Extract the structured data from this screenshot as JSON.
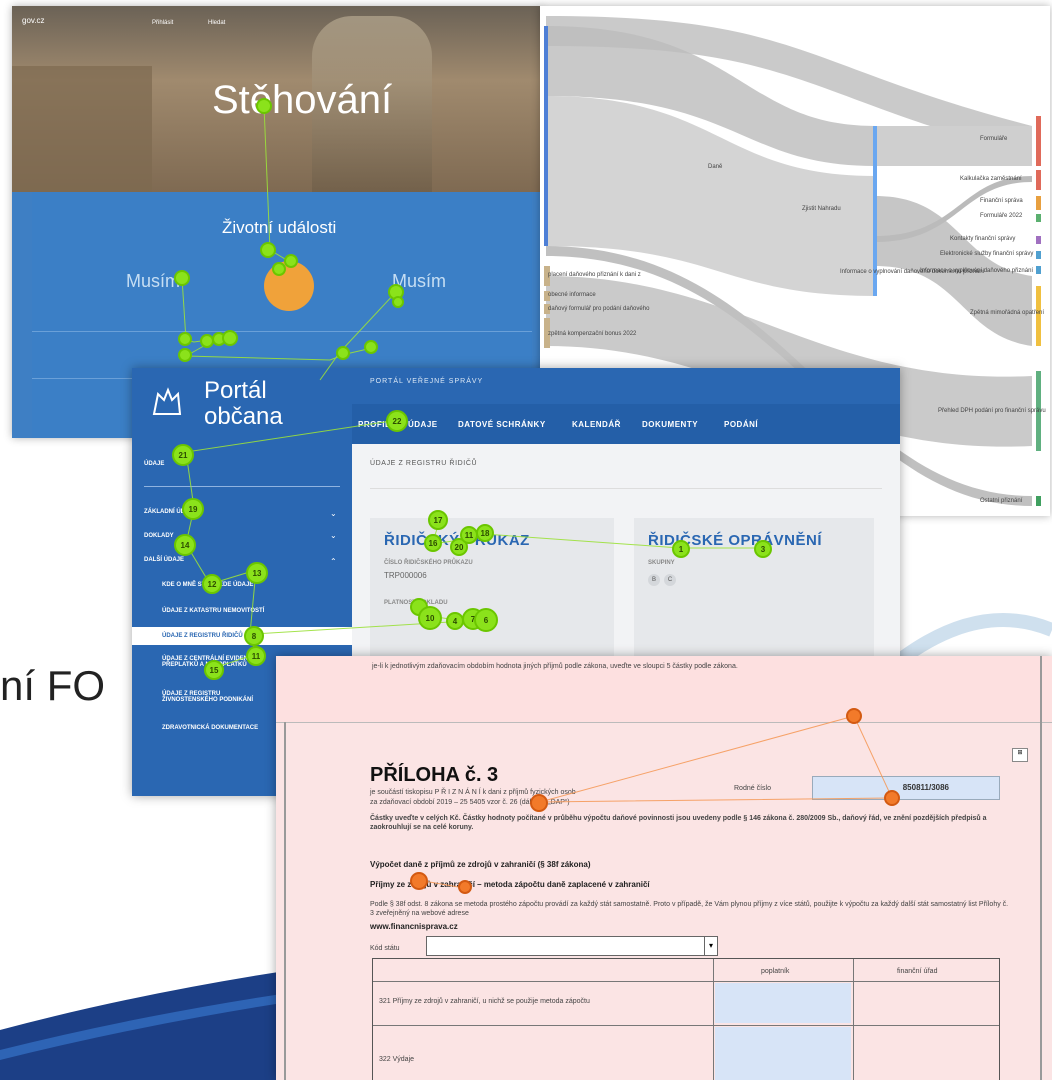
{
  "slide": {
    "text_line1": "ní FO",
    "text_line2": ""
  },
  "stehovani": {
    "topbar_logo": "gov.cz",
    "topbar_links": [
      "Přihlásit",
      "Hledat"
    ],
    "title": "Stěhování",
    "subtitle": "",
    "life_events": "Životní události",
    "must_left": "Musím",
    "must_left_sub": "",
    "must_right": "Musím",
    "must_right_sub": ""
  },
  "portal": {
    "logo_line1": "Portál",
    "logo_line2": "občana",
    "breadcrumb": "PORTÁL VEŘEJNÉ SPRÁVY",
    "nav": [
      "PROFIL",
      "ÚDAJE",
      "DATOVÉ SCHRÁNKY",
      "KALENDÁŘ",
      "DOKUMENTY",
      "PODÁNÍ"
    ],
    "side_head": "ÚDAJE",
    "side_items": [
      "ZÁKLADNÍ ÚDAJE",
      "DOKLADY",
      "DALŠÍ ÚDAJE",
      "KDE O MNĚ STÁT VEDE ÚDAJE",
      "ÚDAJE Z KATASTRU NEMOVITOSTÍ",
      "ÚDAJE Z REGISTRU ŘIDIČŮ",
      "ÚDAJE Z CENTRÁLNÍ EVIDENCE PŘEPLATKŮ A NEDOPLATKŮ",
      "ÚDAJE Z REGISTRU ŽIVNOSTENSKÉHO PODNIKÁNÍ",
      "ZDRAVOTNICKÁ DOKUMENTACE"
    ],
    "main_title": "ÚDAJE Z REGISTRU ŘIDIČŮ",
    "card1_title": "ŘIDIČSKÝ PRŮKAZ",
    "card1_label": "ČÍSLO ŘIDIČSKÉHO PRŮKAZU",
    "card1_value": "TRP000006",
    "card1_label2": "PLATNOST DOKLADU",
    "card1_value2": "",
    "card2_title": "ŘIDIČSKÉ OPRÁVNĚNÍ",
    "card2_label": "SKUPINY",
    "card2_badges": [
      "B",
      "C"
    ]
  },
  "sankey": {
    "left_labels": [
      "placení daňového přiznání k dani z",
      "obecné informace",
      "daňový formulář pro podání daňového",
      "zpětná kompenzační bonus 2022"
    ],
    "mid_labels": [
      "Daně",
      "Zjistit Nahradu",
      "Informace o vyplnování daňového dokumentu přiznání"
    ],
    "right_labels": [
      "Formuláře",
      "Kalkulačka zaměstnání",
      "Finanční správa",
      "Formuláře 2022",
      "Kontakty finanční správy",
      "Elektronické služby finanční správy",
      "Informace o vyplňování daňového přiznání",
      "Zpětná mimořádná opatření",
      "Přehled DPH podání pro finanční správu",
      "Ostatní přiznání"
    ]
  },
  "taxform": {
    "top_text": "je-li k jednotlivým zdaňovacím obdobím hodnota jiných příjmů podle zákona, uveďte ve sloupci 5 částky podle zákona.",
    "heading": "PŘÍLOHA č. 3",
    "sub1": "je součástí tiskopisu P Ř I Z N Á N Í k dani z příjmů fyzických osob",
    "sub2": "za zdaňovací období 2019 – 25 5405 vzor č. 26 (dále jen „DAP“)",
    "rodne_label": "Rodné číslo",
    "rodne_value": "850811/3086",
    "para1": "Částky uveďte v celých Kč. Částky hodnoty počítané v průběhu výpočtu daňové povinnosti jsou uvedeny podle § 146 zákona č. 280/2009 Sb., daňový řád, ve znění pozdějších předpisů a zaokrouhlují se na celé koruny.",
    "section": "Výpočet daně z příjmů ze zdrojů v zahraničí (§ 38f zákona)",
    "subsection": "Příjmy ze zdrojů v zahraničí – metoda zápočtu daně zaplacené v zahraničí",
    "para2": "Podle § 38f odst. 8 zákona se metoda prostého zápočtu provádí za každý stát samostatně. Proto v případě, že Vám plynou příjmy z více států, použijte k výpočtu za každý další stát samostatný list Přílohy č. 3 zveřejněný na webové adrese",
    "url": "www.financnisprava.cz",
    "kod_label": "Kód státu",
    "col_payer": "poplatník",
    "col_office": "finanční úřad",
    "row321": "321   Příjmy ze zdrojů v zahraničí, u nichž se použije metoda zápočtu",
    "row322": "322   Výdaje"
  }
}
